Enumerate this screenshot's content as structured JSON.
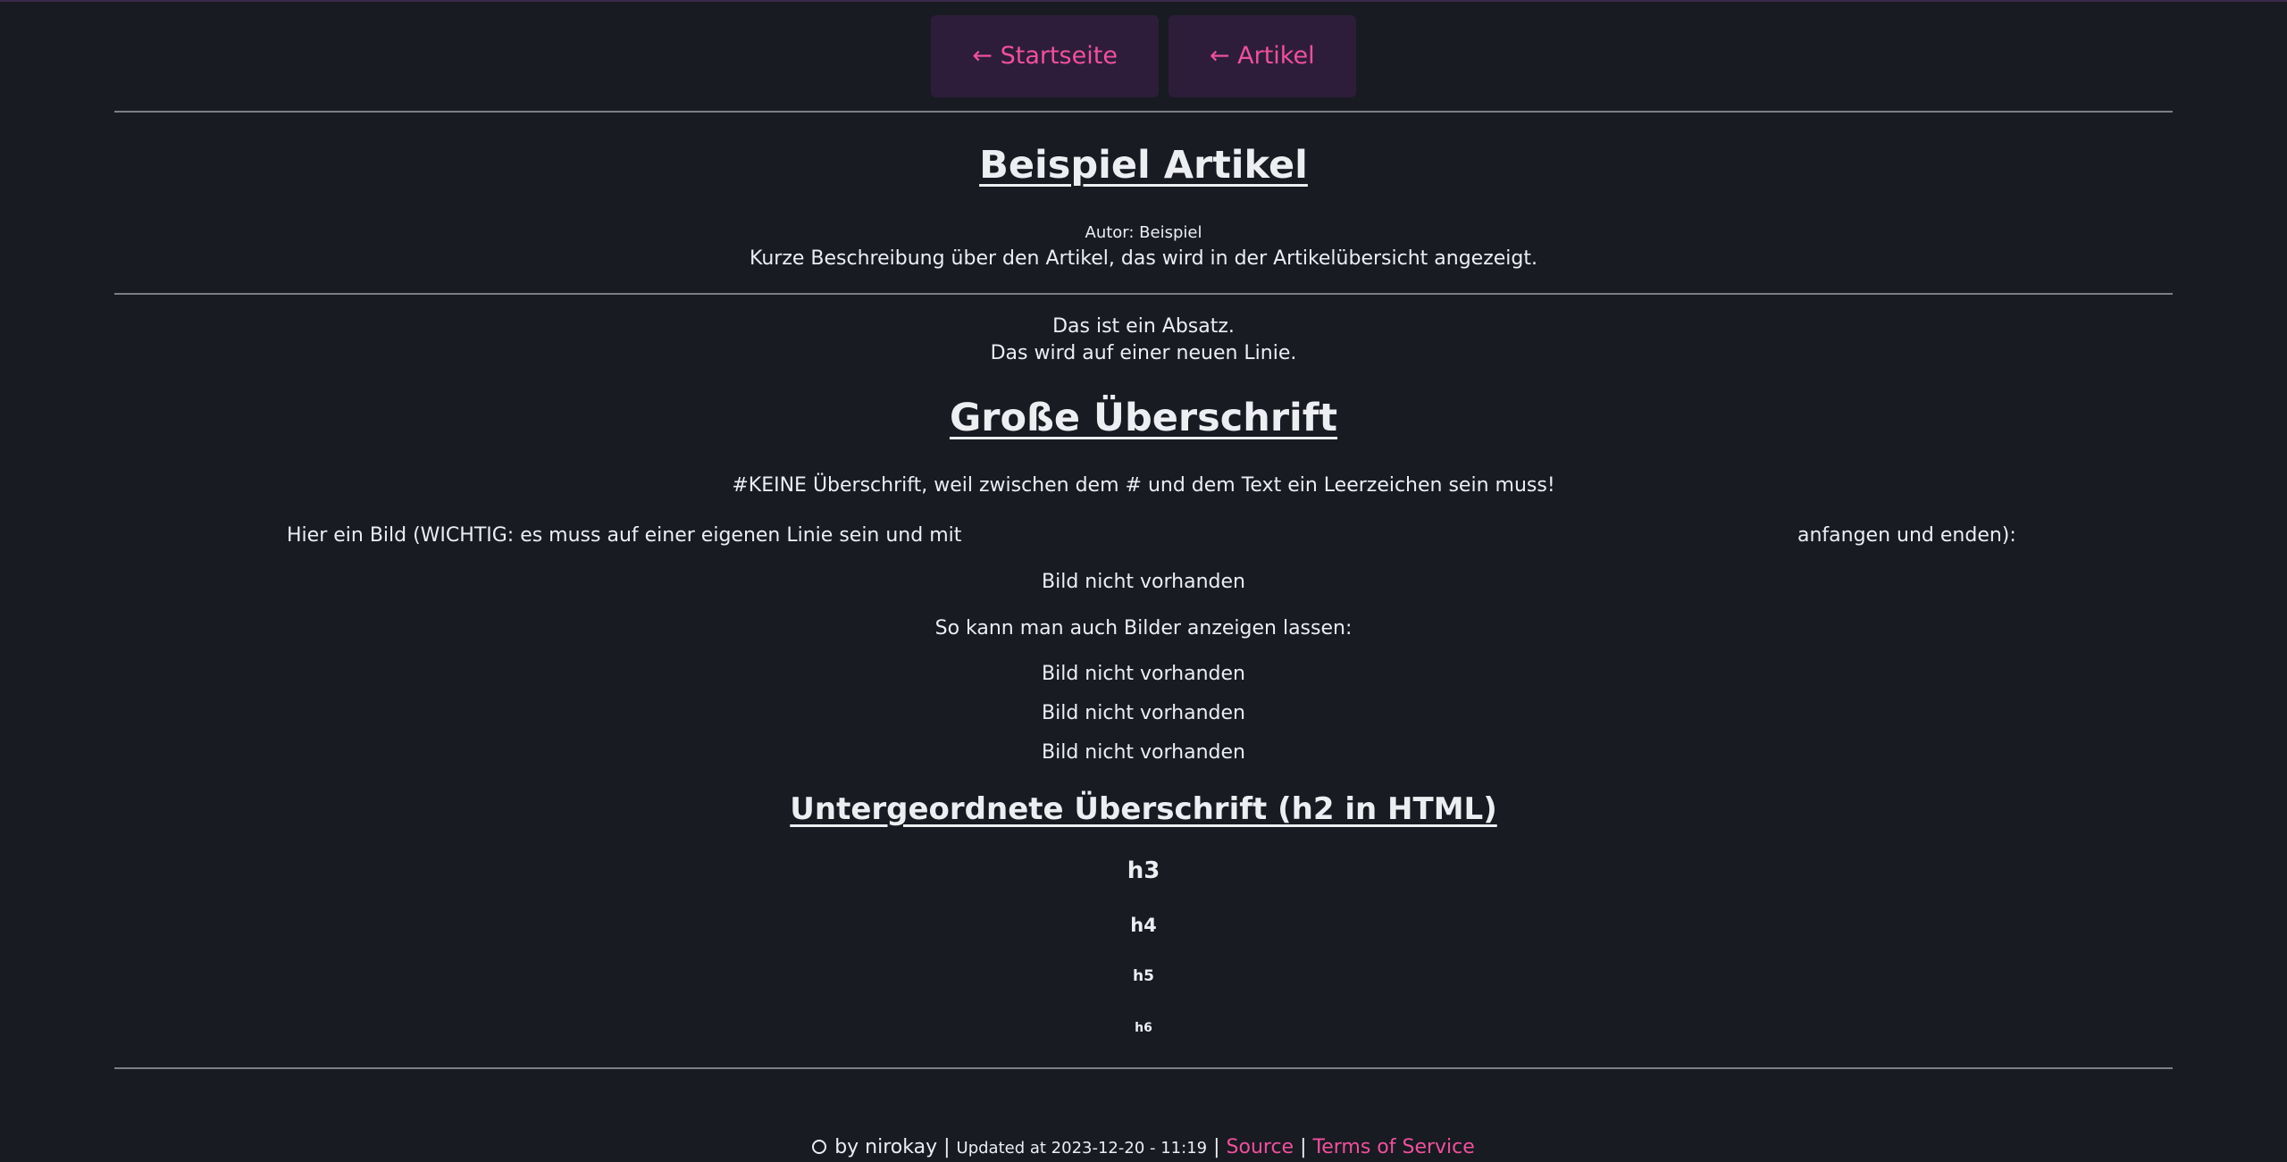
{
  "nav": {
    "home_label": "← Startseite",
    "articles_label": "← Artikel"
  },
  "article": {
    "title": "Beispiel Artikel",
    "author": "Autor: Beispiel",
    "description": "Kurze Beschreibung über den Artikel, das wird in der Artikelübersicht angezeigt."
  },
  "content": {
    "paragraph_line1": "Das ist ein Absatz.",
    "paragraph_line2": "Das wird auf einer neuen Linie.",
    "big_heading": "Große Überschrift",
    "no_heading_text": "#KEINE Überschrift, weil zwischen dem # und dem Text ein Leerzeichen sein muss!",
    "image_hint_left": "Hier ein Bild (WICHTIG: es muss auf einer eigenen Linie sein und mit",
    "image_hint_right": "anfangen und enden):",
    "missing_image_1": "Bild nicht vorhanden",
    "images_intro": "So kann man auch Bilder anzeigen lassen:",
    "missing_image_2": "Bild nicht vorhanden",
    "missing_image_3": "Bild nicht vorhanden",
    "missing_image_4": "Bild nicht vorhanden",
    "sub_heading": "Untergeordnete Überschrift (h2 in HTML)",
    "h3": "h3",
    "h4": "h4",
    "h5": "h5",
    "h6": "h6"
  },
  "footer": {
    "by": "by nirokay",
    "separator": "|",
    "updated": "Updated at 2023-12-20 - 11:19",
    "source_label": "Source",
    "tos_label": "Terms of Service"
  },
  "colors": {
    "background": "#181b22",
    "accent": "#f0509e",
    "button_bg": "#2e1d3a",
    "text": "#eceef2"
  }
}
